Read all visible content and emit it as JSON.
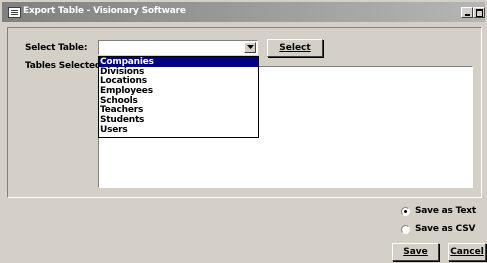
{
  "window": {
    "title": "Export Table - Visionary Software"
  },
  "form": {
    "select_table_label": "Select Table:",
    "tables_selected_label": "Tables Selected:",
    "combo_value": "",
    "select_button_label": "Select"
  },
  "dropdown": {
    "items": [
      "Companies",
      "Divisions",
      "Locations",
      "Employees",
      "Schools",
      "Teachers",
      "Students",
      "Users"
    ],
    "selected_index": 0
  },
  "options": {
    "save_as_text_label": "Save as Text",
    "save_as_csv_label": "Save as CSV",
    "selected": "save_as_text"
  },
  "buttons": {
    "save_label": "Save",
    "cancel_label": "Cancel"
  },
  "icons": {
    "app": "app-window-icon",
    "minimize": "minimize-icon",
    "maximize": "maximize-icon",
    "dropdown": "chevron-down-icon"
  }
}
